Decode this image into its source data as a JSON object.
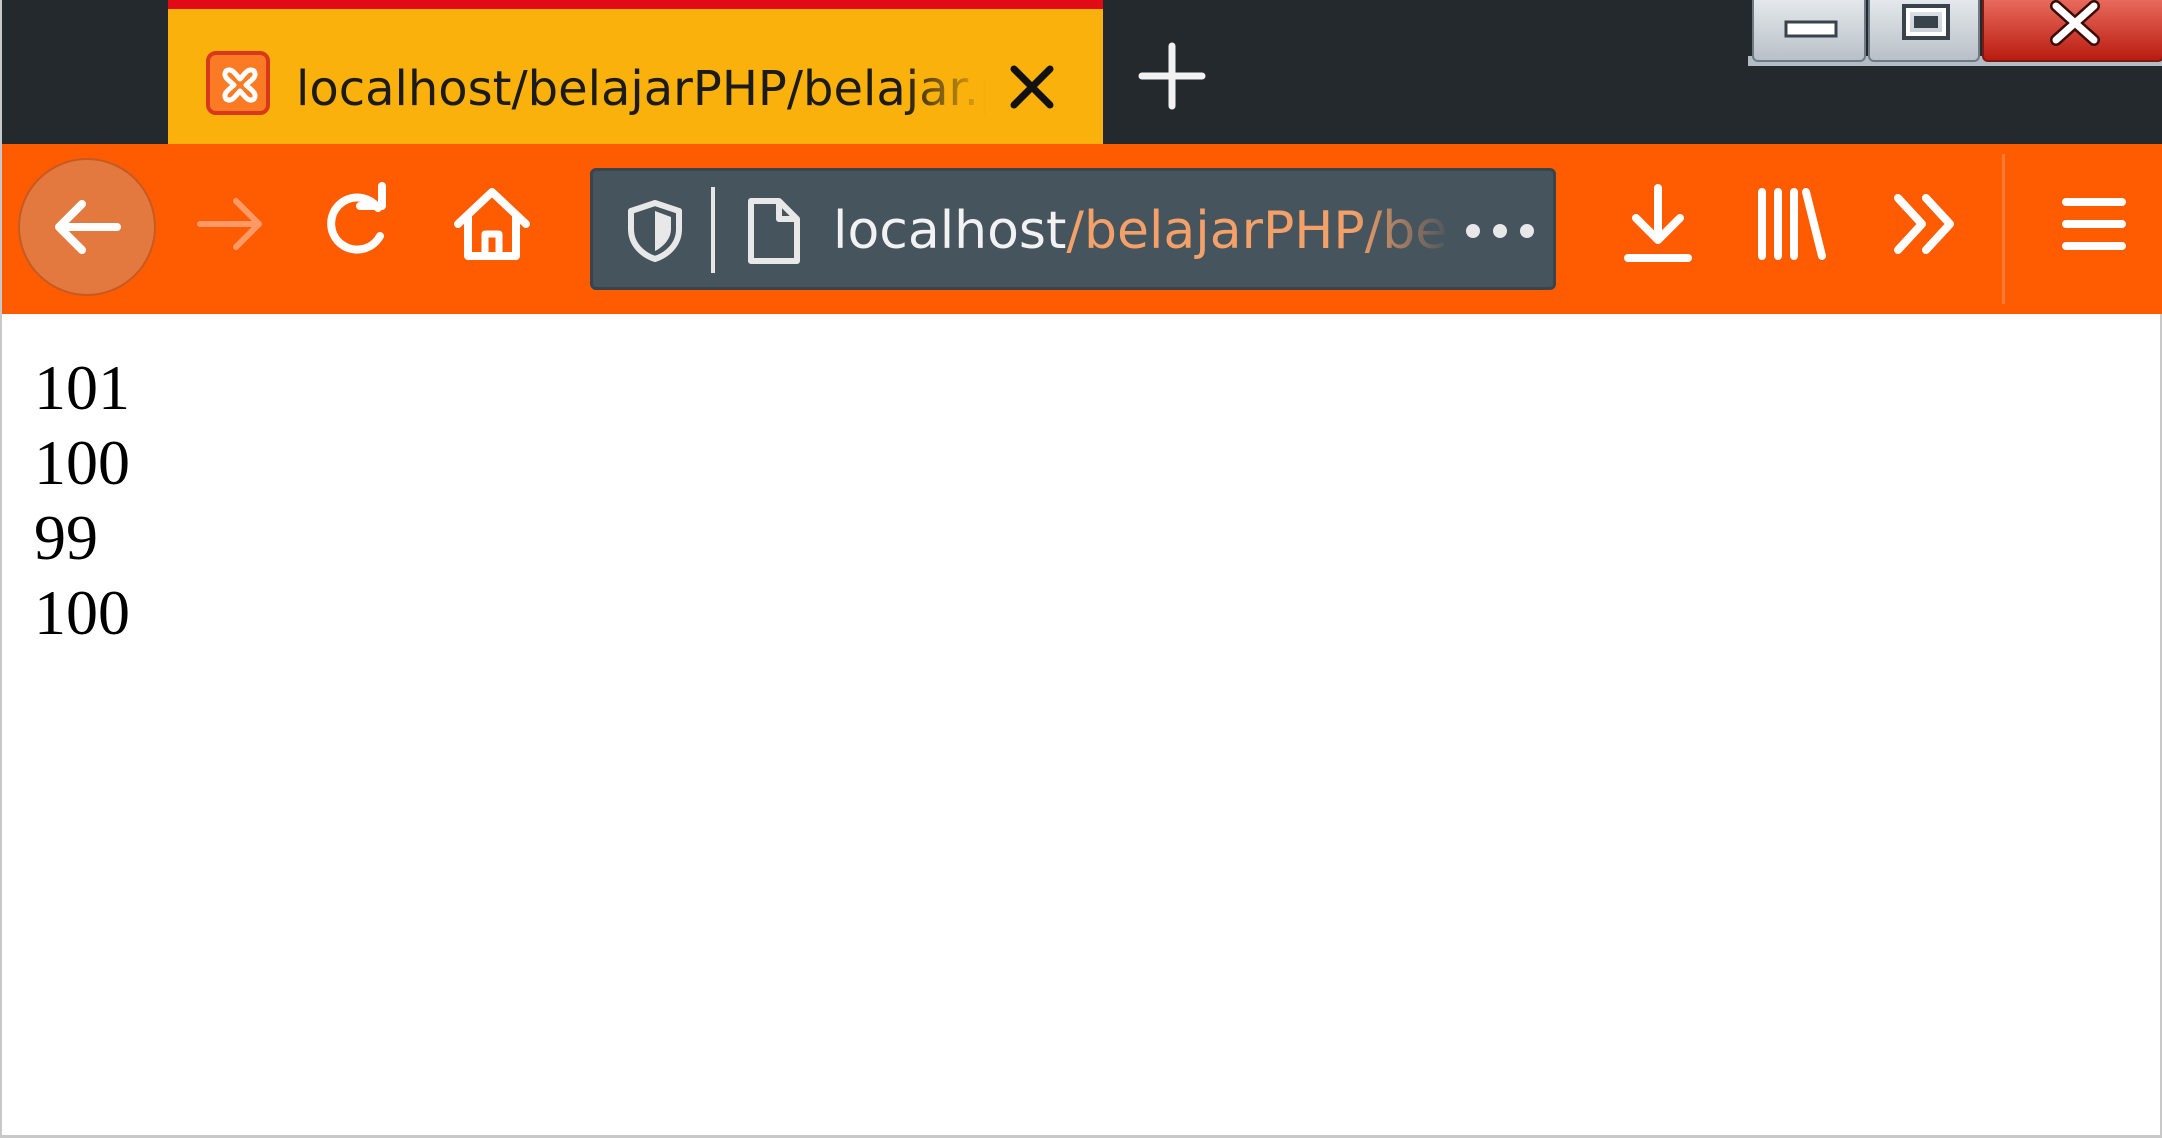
{
  "tab": {
    "title": "localhost/belajarPHP/belajar.php",
    "favicon": "xampp-icon",
    "close_icon": "close-icon"
  },
  "new_tab_icon": "plus-icon",
  "window_controls": [
    "minimize-icon",
    "maximize-icon",
    "close-icon"
  ],
  "toolbar": {
    "back_icon": "arrow-left-icon",
    "forward_icon": "arrow-right-icon",
    "reload_icon": "reload-icon",
    "home_icon": "home-icon",
    "downloads_icon": "download-icon",
    "library_icon": "library-icon",
    "overflow_icon": "chevron-double-right-icon",
    "menu_icon": "hamburger-icon"
  },
  "urlbar": {
    "host": "localhost",
    "path": "/belajarPHP/belajar.php",
    "shield_icon": "shield-icon",
    "page_icon": "page-icon",
    "actions_icon": "more-dots-icon"
  },
  "colors": {
    "tab_active": "#fbb10b",
    "tab_accent": "#e00b17",
    "toolbar": "#ff5b01",
    "urlbar": "#46545e",
    "tabstrip": "#23292d",
    "url_path": "#f3a168"
  },
  "page_output": [
    "101",
    "100",
    "99",
    "100"
  ]
}
